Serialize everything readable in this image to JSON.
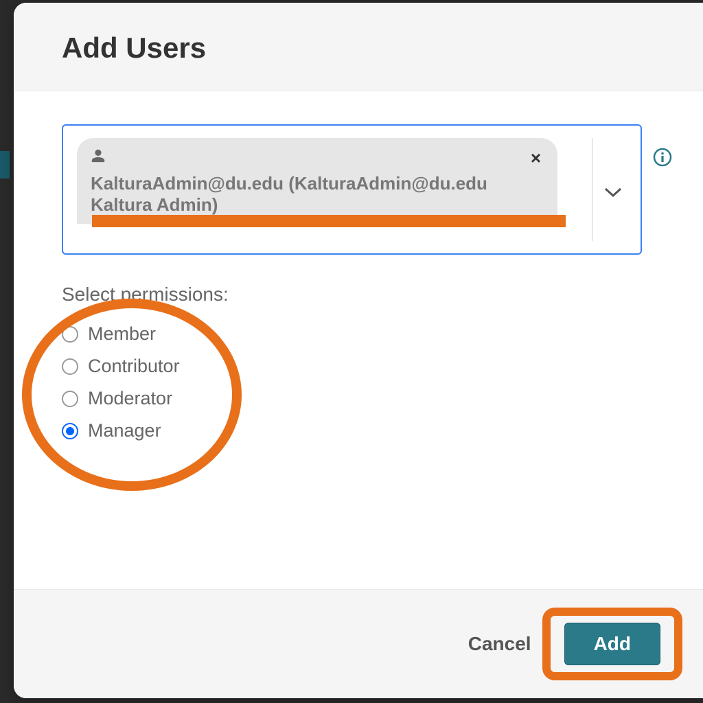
{
  "modal": {
    "title": "Add Users",
    "user_chip": {
      "text": "KalturaAdmin@du.edu (KalturaAdmin@du.edu Kaltura Admin)"
    },
    "permissions_label": "Select permissions:",
    "permissions": [
      {
        "label": "Member",
        "selected": false
      },
      {
        "label": "Contributor",
        "selected": false
      },
      {
        "label": "Moderator",
        "selected": false
      },
      {
        "label": "Manager",
        "selected": true
      }
    ],
    "footer": {
      "cancel_label": "Cancel",
      "add_label": "Add"
    }
  },
  "colors": {
    "accent_orange": "#e8701a",
    "primary_teal": "#2a7a8a",
    "focus_blue": "#3b82f6",
    "radio_blue": "#0066ff"
  }
}
